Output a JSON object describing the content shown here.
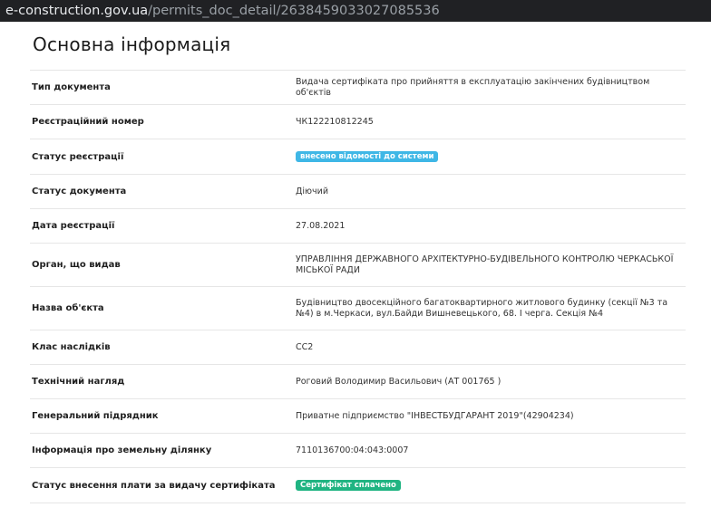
{
  "browser": {
    "url_domain": "e-construction.gov.ua",
    "url_path": "/permits_doc_detail/2638459033027085536"
  },
  "section": {
    "title": "Основна інформація"
  },
  "colors": {
    "registration_badge": "#3fb7e6",
    "payment_badge": "#20b482"
  },
  "rows": [
    {
      "label": "Тип документа",
      "value": "Видача сертифіката про прийняття в експлуатацію закінчених будівництвом об'єктів"
    },
    {
      "label": "Реєстраційний номер",
      "value": "ЧК122210812245"
    },
    {
      "label": "Статус реєстрації",
      "badge": "внесено відомості до системи"
    },
    {
      "label": "Статус документа",
      "value": "Діючий"
    },
    {
      "label": "Дата реєстрації",
      "value": "27.08.2021"
    },
    {
      "label": "Орган, що видав",
      "value": "УПРАВЛІННЯ ДЕРЖАВНОГО АРХІТЕКТУРНО-БУДІВЕЛЬНОГО КОНТРОЛЮ ЧЕРКАСЬКОЇ МІСЬКОЇ РАДИ"
    },
    {
      "label": "Назва об'єкта",
      "value": "Будівництво двосекційного багатоквартирного житлового будинку (секції №3 та №4) в м.Черкаси, вул.Байди Вишневецького, 68. І черга. Секція №4"
    },
    {
      "label": "Клас наслідків",
      "value": "СС2"
    },
    {
      "label": "Технічний нагляд",
      "value": "Роговий Володимир Васильович (АТ 001765 )"
    },
    {
      "label": "Генеральний підрядник",
      "value": "Приватне підприємство \"ІНВЕСТБУДГАРАНТ 2019\"(42904234)"
    },
    {
      "label": "Інформація про земельну ділянку",
      "value": "7110136700:04:043:0007"
    },
    {
      "label": "Статус внесення плати за видачу сертифіката",
      "badge": "Сертифікат сплачено"
    }
  ]
}
